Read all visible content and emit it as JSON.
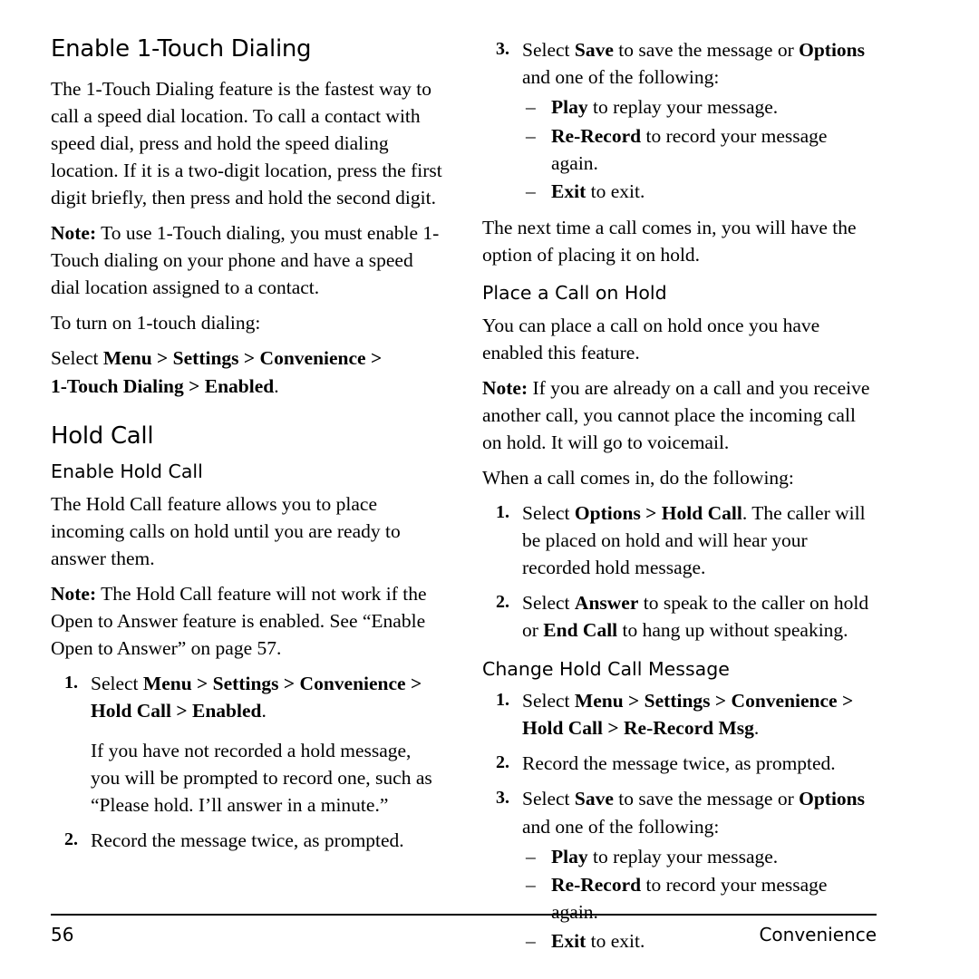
{
  "document": {
    "page_number": "56",
    "footer_section": "Convenience"
  },
  "left_column": {
    "h1_enable_1touch": "Enable 1-Touch Dialing",
    "p_intro": "The 1-Touch Dialing feature is the fastest way to call a speed dial location. To call a contact with speed dial, press and hold the speed dialing location. If it is a two-digit location, press the first digit briefly, then press and hold the second digit.",
    "note_label": "Note:",
    "p_note": " To use 1-Touch dialing, you must enable 1-Touch dialing on your phone and have a speed dial location assigned to a contact.",
    "p_turn_on": "To turn on 1-touch dialing:",
    "select_word": "Select",
    "path_menu_settings_convenience": "Menu > Settings > Convenience >",
    "path_1touch_enabled": "1-Touch Dialing > Enabled",
    "path_period": ".",
    "h1_hold_call": "Hold Call",
    "h2_enable_hold_call": "Enable Hold Call",
    "p_hold_feature": "The Hold Call feature allows you to place incoming calls on hold until you are ready to answer them.",
    "p_note2": " The Hold Call feature will not work if the Open to Answer feature is enabled. See “Enable Open to Answer” on page 57.",
    "step1_num": "1.",
    "step1_select": "Select ",
    "step1_path1": "Menu > Settings > Convenience >",
    "step1_path2": "Hold Call > Enabled",
    "step1_end": ".",
    "step1_body": "If you have not recorded a hold message, you will be prompted to record one, such as “Please hold. I’ll answer in a minute.”",
    "step2_num": "2.",
    "step2_text": "Record the message twice, as prompted."
  },
  "right_column": {
    "step3_num": "3.",
    "step3_select": "Select ",
    "step3_save": "Save",
    "step3_mid": " to save the message or ",
    "step3_options": "Options",
    "step3_end": " and one of the following:",
    "dash": "–",
    "play_label": "Play",
    "play_text": " to replay your message.",
    "rerecord_label": "Re-Record",
    "rerecord_text": " to record your message again.",
    "exit_label": "Exit",
    "exit_text": " to exit.",
    "p_next_time": "The next time a call comes in, you will have the option of placing it on hold.",
    "h2_place_call": "Place a Call on Hold",
    "p_place": "You can place a call on hold once you have enabled this feature.",
    "note_label": "Note:",
    "p_note3": " If you are already on a call and you receive another call, you cannot place the incoming call on hold. It will go to voicemail.",
    "p_when_call": "When a call comes in, do the following:",
    "r_step1_num": "1.",
    "r_step1_select": "Select ",
    "r_step1_path": "Options > Hold Call",
    "r_step1_rest": ". The caller will be placed on hold and will hear your recorded hold message.",
    "r_step2_num": "2.",
    "r_step2_select": "Select ",
    "r_step2_answer": "Answer",
    "r_step2_mid": " to speak to the caller on hold or ",
    "r_step2_endcall": "End Call",
    "r_step2_end": " to hang up without speaking.",
    "h2_change_msg": "Change Hold Call Message",
    "c_step1_num": "1.",
    "c_step1_select": "Select ",
    "c_step1_path1": "Menu  > Settings > Convenience >",
    "c_step1_path2": "Hold Call >  Re-Record Msg",
    "c_step1_end": ".",
    "c_step2_num": "2.",
    "c_step2_text": "Record the message twice, as prompted.",
    "c_step3_num": "3.",
    "c_step3_select": "Select ",
    "c_step3_save": "Save",
    "c_step3_mid": " to save the message or ",
    "c_step3_options": "Options",
    "c_step3_end": " and one of the following:"
  }
}
